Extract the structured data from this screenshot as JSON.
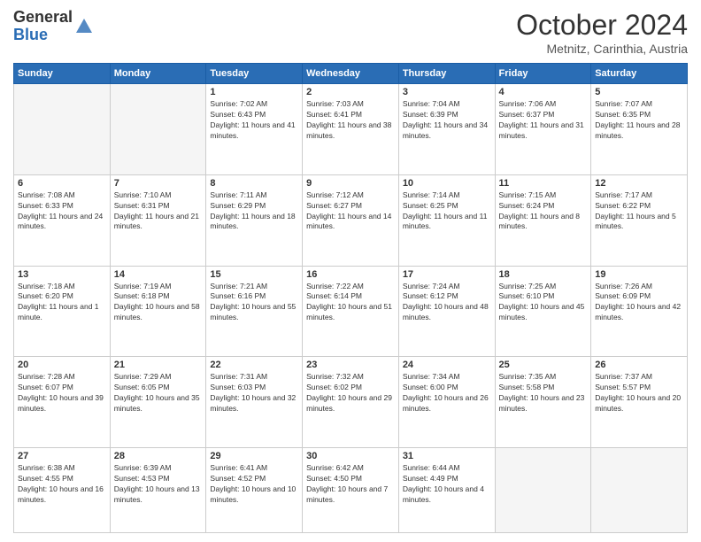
{
  "header": {
    "logo_general": "General",
    "logo_blue": "Blue",
    "month_title": "October 2024",
    "location": "Metnitz, Carinthia, Austria"
  },
  "days_of_week": [
    "Sunday",
    "Monday",
    "Tuesday",
    "Wednesday",
    "Thursday",
    "Friday",
    "Saturday"
  ],
  "weeks": [
    [
      {
        "day": "",
        "empty": true
      },
      {
        "day": "",
        "empty": true
      },
      {
        "day": "1",
        "sunrise": "7:02 AM",
        "sunset": "6:43 PM",
        "daylight": "11 hours and 41 minutes."
      },
      {
        "day": "2",
        "sunrise": "7:03 AM",
        "sunset": "6:41 PM",
        "daylight": "11 hours and 38 minutes."
      },
      {
        "day": "3",
        "sunrise": "7:04 AM",
        "sunset": "6:39 PM",
        "daylight": "11 hours and 34 minutes."
      },
      {
        "day": "4",
        "sunrise": "7:06 AM",
        "sunset": "6:37 PM",
        "daylight": "11 hours and 31 minutes."
      },
      {
        "day": "5",
        "sunrise": "7:07 AM",
        "sunset": "6:35 PM",
        "daylight": "11 hours and 28 minutes."
      }
    ],
    [
      {
        "day": "6",
        "sunrise": "7:08 AM",
        "sunset": "6:33 PM",
        "daylight": "11 hours and 24 minutes."
      },
      {
        "day": "7",
        "sunrise": "7:10 AM",
        "sunset": "6:31 PM",
        "daylight": "11 hours and 21 minutes."
      },
      {
        "day": "8",
        "sunrise": "7:11 AM",
        "sunset": "6:29 PM",
        "daylight": "11 hours and 18 minutes."
      },
      {
        "day": "9",
        "sunrise": "7:12 AM",
        "sunset": "6:27 PM",
        "daylight": "11 hours and 14 minutes."
      },
      {
        "day": "10",
        "sunrise": "7:14 AM",
        "sunset": "6:25 PM",
        "daylight": "11 hours and 11 minutes."
      },
      {
        "day": "11",
        "sunrise": "7:15 AM",
        "sunset": "6:24 PM",
        "daylight": "11 hours and 8 minutes."
      },
      {
        "day": "12",
        "sunrise": "7:17 AM",
        "sunset": "6:22 PM",
        "daylight": "11 hours and 5 minutes."
      }
    ],
    [
      {
        "day": "13",
        "sunrise": "7:18 AM",
        "sunset": "6:20 PM",
        "daylight": "11 hours and 1 minute."
      },
      {
        "day": "14",
        "sunrise": "7:19 AM",
        "sunset": "6:18 PM",
        "daylight": "10 hours and 58 minutes."
      },
      {
        "day": "15",
        "sunrise": "7:21 AM",
        "sunset": "6:16 PM",
        "daylight": "10 hours and 55 minutes."
      },
      {
        "day": "16",
        "sunrise": "7:22 AM",
        "sunset": "6:14 PM",
        "daylight": "10 hours and 51 minutes."
      },
      {
        "day": "17",
        "sunrise": "7:24 AM",
        "sunset": "6:12 PM",
        "daylight": "10 hours and 48 minutes."
      },
      {
        "day": "18",
        "sunrise": "7:25 AM",
        "sunset": "6:10 PM",
        "daylight": "10 hours and 45 minutes."
      },
      {
        "day": "19",
        "sunrise": "7:26 AM",
        "sunset": "6:09 PM",
        "daylight": "10 hours and 42 minutes."
      }
    ],
    [
      {
        "day": "20",
        "sunrise": "7:28 AM",
        "sunset": "6:07 PM",
        "daylight": "10 hours and 39 minutes."
      },
      {
        "day": "21",
        "sunrise": "7:29 AM",
        "sunset": "6:05 PM",
        "daylight": "10 hours and 35 minutes."
      },
      {
        "day": "22",
        "sunrise": "7:31 AM",
        "sunset": "6:03 PM",
        "daylight": "10 hours and 32 minutes."
      },
      {
        "day": "23",
        "sunrise": "7:32 AM",
        "sunset": "6:02 PM",
        "daylight": "10 hours and 29 minutes."
      },
      {
        "day": "24",
        "sunrise": "7:34 AM",
        "sunset": "6:00 PM",
        "daylight": "10 hours and 26 minutes."
      },
      {
        "day": "25",
        "sunrise": "7:35 AM",
        "sunset": "5:58 PM",
        "daylight": "10 hours and 23 minutes."
      },
      {
        "day": "26",
        "sunrise": "7:37 AM",
        "sunset": "5:57 PM",
        "daylight": "10 hours and 20 minutes."
      }
    ],
    [
      {
        "day": "27",
        "sunrise": "6:38 AM",
        "sunset": "4:55 PM",
        "daylight": "10 hours and 16 minutes."
      },
      {
        "day": "28",
        "sunrise": "6:39 AM",
        "sunset": "4:53 PM",
        "daylight": "10 hours and 13 minutes."
      },
      {
        "day": "29",
        "sunrise": "6:41 AM",
        "sunset": "4:52 PM",
        "daylight": "10 hours and 10 minutes."
      },
      {
        "day": "30",
        "sunrise": "6:42 AM",
        "sunset": "4:50 PM",
        "daylight": "10 hours and 7 minutes."
      },
      {
        "day": "31",
        "sunrise": "6:44 AM",
        "sunset": "4:49 PM",
        "daylight": "10 hours and 4 minutes."
      },
      {
        "day": "",
        "empty": true
      },
      {
        "day": "",
        "empty": true
      }
    ]
  ],
  "labels": {
    "sunrise": "Sunrise:",
    "sunset": "Sunset:",
    "daylight": "Daylight:"
  }
}
